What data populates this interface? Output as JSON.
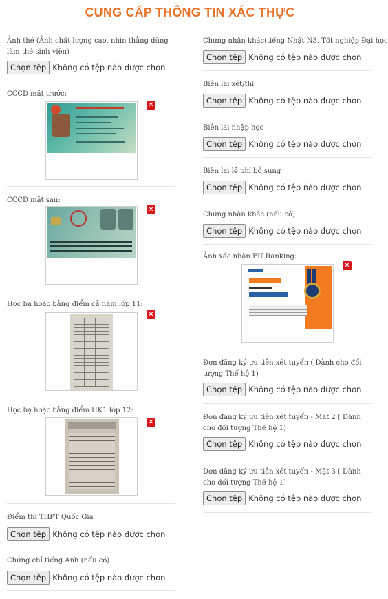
{
  "title": "CUNG CẤP THÔNG TIN XÁC THỰC",
  "file_input": {
    "button_label": "Chọn tệp",
    "no_file_text": "Không có tệp nào được chọn"
  },
  "left": {
    "anh_the": {
      "label": "Ảnh thẻ (Ảnh chất lượng cao, nhìn thẳng dùng làm thẻ sinh viên)"
    },
    "cccd_truoc": {
      "label": "CCCD mặt trước:"
    },
    "cccd_sau": {
      "label": "CCCD mặt sau:"
    },
    "hoc_ba_11": {
      "label": "Học bạ hoặc bảng điểm cả năm lớp 11:"
    },
    "hoc_ba_12": {
      "label": "Học bạ hoặc bảng điểm HK1 lớp 12:"
    },
    "diem_thi": {
      "label": "Điểm thi THPT Quốc Gia"
    },
    "tieng_anh": {
      "label": "Chứng chỉ tiếng Anh (nếu có)"
    }
  },
  "right": {
    "chung_nhan_khac_n3": {
      "label": "Chứng nhận khác(tiếng Nhật N3, Tốt nghiệp Đại học...)"
    },
    "bien_lai_xet_thi": {
      "label": "Biên lai xét/thi"
    },
    "bien_lai_nhap_hoc": {
      "label": "Biên lai nhập học"
    },
    "bien_lai_le_phi": {
      "label": "Biên lai lệ phí bổ sung"
    },
    "chung_nhan_khac": {
      "label": "Chứng nhận khác (nếu có)"
    },
    "fu_ranking": {
      "label": "Ảnh xác nhận FU Ranking:"
    },
    "don_uu_tien_1": {
      "label": "Đơn đăng ký ưu tiên xét tuyển ( Dành cho đối tượng Thế hệ 1)"
    },
    "don_uu_tien_2": {
      "label": "Đơn đăng ký ưu tiên xét tuyển - Mặt 2 ( Dành cho đối tượng Thế hệ 1)"
    },
    "don_uu_tien_3": {
      "label": "Đơn đăng ký ưu tiên xét tuyển - Mặt 3 ( Dành cho đối tượng Thế hệ 1)"
    }
  },
  "delete_icon": "close-icon",
  "colors": {
    "title": "#e8732a",
    "rule": "#4a7fc0",
    "delete": "#d8141d"
  }
}
